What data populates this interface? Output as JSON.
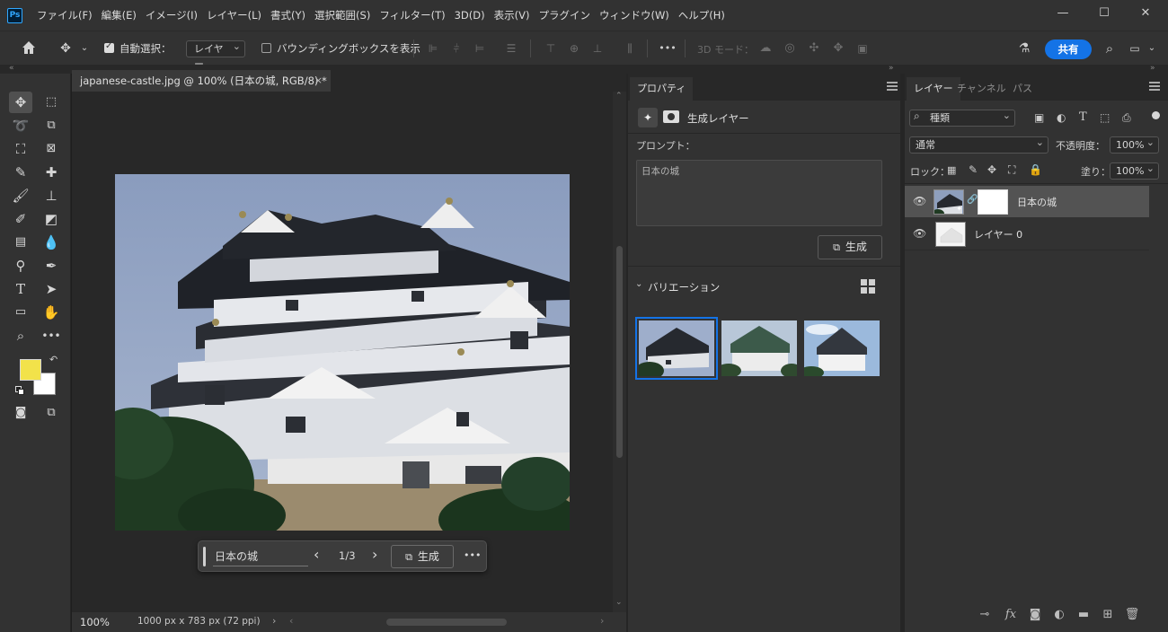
{
  "app": {
    "logo": "Ps",
    "menu": [
      "ファイル(F)",
      "編集(E)",
      "イメージ(I)",
      "レイヤー(L)",
      "書式(Y)",
      "選択範囲(S)",
      "フィルター(T)",
      "3D(D)",
      "表示(V)",
      "プラグイン",
      "ウィンドウ(W)",
      "ヘルプ(H)"
    ],
    "window_controls": {
      "minimize": "—",
      "maximize": "☐",
      "close": "✕"
    }
  },
  "options_bar": {
    "auto_select_label": "自動選択：",
    "auto_select_checked": true,
    "auto_select_target": "レイヤー",
    "bounding_box_label": "バウンディングボックスを表示",
    "bounding_box_checked": false,
    "more": "•••",
    "mode_3d_label": "3D モード：",
    "share_label": "共有"
  },
  "colors": {
    "accent": "#1473e6",
    "foreground": "#f2e24a",
    "background": "#ffffff",
    "ui_bg": "#323232"
  },
  "document": {
    "tab_title": "japanese-castle.jpg @ 100% (日本の城, RGB/8) *",
    "tab_close": "×",
    "zoom": "100%",
    "dimensions": "1000 px x 783 px (72 ppi)"
  },
  "contextual_bar": {
    "prompt": "日本の城",
    "prev": "‹",
    "page": "1/3",
    "next": "›",
    "generate_label": "生成",
    "more": "•••"
  },
  "properties_panel": {
    "tab": "プロパティ",
    "layer_type": "生成レイヤー",
    "prompt_label": "プロンプト：",
    "prompt_value": "日本の城",
    "generate_label": "生成",
    "variations_label": "バリエーション",
    "selected_variation": 1,
    "variation_count": 3
  },
  "layers_panel": {
    "tabs": [
      "レイヤー",
      "チャンネル",
      "パス"
    ],
    "filter_label": "種類",
    "blend_mode": "通常",
    "opacity_label": "不透明度：",
    "opacity_value": "100%",
    "lock_label": "ロック：",
    "fill_label": "塗り：",
    "fill_value": "100%",
    "layers": [
      {
        "name": "日本の城",
        "selected": true,
        "visible": true
      },
      {
        "name": "レイヤー 0",
        "selected": false,
        "visible": true
      }
    ],
    "bottom_icons": [
      "link-icon",
      "fx-icon",
      "mask-icon",
      "adjustment-icon",
      "group-icon",
      "new-layer-icon",
      "trash-icon"
    ],
    "fx_text": "fx"
  }
}
